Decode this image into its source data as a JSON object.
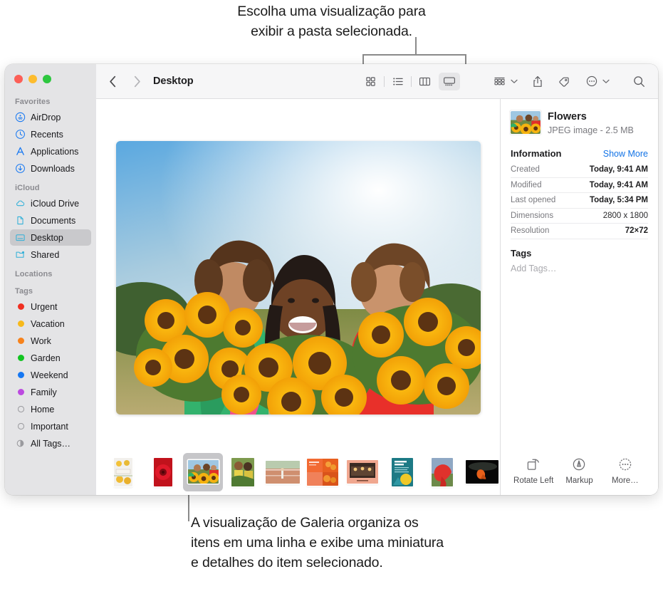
{
  "callouts": {
    "top": [
      "Escolha uma visualização para",
      "exibir a pasta selecionada."
    ],
    "bottom": [
      "A visualização de Galeria organiza os",
      "itens em uma linha e exibe uma miniatura",
      "e detalhes do item selecionado."
    ]
  },
  "window": {
    "traffic_lights": [
      "close",
      "minimize",
      "zoom"
    ],
    "colors": {
      "red": "#fc5f57",
      "yellow": "#fdbc2e",
      "green": "#2dc73f",
      "accent": "#1273e6",
      "selection": "#c9c9cc"
    }
  },
  "sidebar": {
    "sections": [
      {
        "header": "Favorites",
        "items": [
          {
            "label": "AirDrop",
            "icon": "airdrop-icon",
            "selected": false
          },
          {
            "label": "Recents",
            "icon": "clock-icon",
            "selected": false
          },
          {
            "label": "Applications",
            "icon": "applications-icon",
            "selected": false
          },
          {
            "label": "Downloads",
            "icon": "download-icon",
            "selected": false
          }
        ]
      },
      {
        "header": "iCloud",
        "items": [
          {
            "label": "iCloud Drive",
            "icon": "cloud-icon",
            "selected": false
          },
          {
            "label": "Documents",
            "icon": "document-icon",
            "selected": false
          },
          {
            "label": "Desktop",
            "icon": "desktop-icon",
            "selected": true
          },
          {
            "label": "Shared",
            "icon": "shared-folder-icon",
            "selected": false
          }
        ]
      },
      {
        "header": "Locations",
        "items": []
      },
      {
        "header": "Tags",
        "items": [
          {
            "label": "Urgent",
            "icon": "tag-dot-icon",
            "color": "#f02f21",
            "selected": false
          },
          {
            "label": "Vacation",
            "icon": "tag-dot-icon",
            "color": "#f7b91b",
            "selected": false
          },
          {
            "label": "Work",
            "icon": "tag-dot-icon",
            "color": "#f7821b",
            "selected": false
          },
          {
            "label": "Garden",
            "icon": "tag-dot-icon",
            "color": "#12c421",
            "selected": false
          },
          {
            "label": "Weekend",
            "icon": "tag-dot-icon",
            "color": "#1577f2",
            "selected": false
          },
          {
            "label": "Family",
            "icon": "tag-dot-icon",
            "color": "#bc4ae0",
            "selected": false
          },
          {
            "label": "Home",
            "icon": "tag-dot-hollow-icon",
            "color": "",
            "selected": false
          },
          {
            "label": "Important",
            "icon": "tag-dot-hollow-icon",
            "color": "",
            "selected": false
          },
          {
            "label": "All Tags…",
            "icon": "all-tags-icon",
            "color": "",
            "selected": false
          }
        ]
      }
    ]
  },
  "toolbar": {
    "back": "back-icon",
    "forward": "forward-icon",
    "title": "Desktop",
    "view_buttons": [
      {
        "name": "icon-view",
        "label": "Icon View",
        "active": false
      },
      {
        "name": "list-view",
        "label": "List View",
        "active": false
      },
      {
        "name": "column-view",
        "label": "Column View",
        "active": false
      },
      {
        "name": "gallery-view",
        "label": "Gallery View",
        "active": true
      }
    ],
    "actions": [
      {
        "name": "group-by",
        "label": "Group",
        "has_chevron": true
      },
      {
        "name": "share",
        "label": "Share",
        "has_chevron": false
      },
      {
        "name": "tags",
        "label": "Tags",
        "has_chevron": false
      },
      {
        "name": "more",
        "label": "More",
        "has_chevron": true
      },
      {
        "name": "search",
        "label": "Search",
        "has_chevron": false
      }
    ]
  },
  "gallery": {
    "preview_alt": "Three people holding large bouquets of sunflowers in a field",
    "filmstrip": [
      {
        "name": "district-poster",
        "selected": false
      },
      {
        "name": "red-flower",
        "selected": false
      },
      {
        "name": "flowers",
        "selected": true
      },
      {
        "name": "market-greens",
        "selected": false
      },
      {
        "name": "runner-track",
        "selected": false
      },
      {
        "name": "orange-collage",
        "selected": false
      },
      {
        "name": "restaurant-card",
        "selected": false
      },
      {
        "name": "marketing-flyer",
        "selected": false
      },
      {
        "name": "red-scarf-field",
        "selected": false
      },
      {
        "name": "dark-abstract",
        "selected": false
      },
      {
        "name": "chart-document",
        "selected": false
      }
    ]
  },
  "info": {
    "name": "Flowers",
    "subtitle": "JPEG image - 2.5 MB",
    "section_title": "Information",
    "show_more": "Show More",
    "rows": [
      {
        "key": "Created",
        "value": "Today, 9:41 AM",
        "bold": true
      },
      {
        "key": "Modified",
        "value": "Today, 9:41 AM",
        "bold": true
      },
      {
        "key": "Last opened",
        "value": "Today, 5:34 PM",
        "bold": true
      },
      {
        "key": "Dimensions",
        "value": "2800 x 1800",
        "bold": false
      },
      {
        "key": "Resolution",
        "value": "72×72",
        "bold": true
      }
    ],
    "tags_title": "Tags",
    "add_tags": "Add Tags…",
    "actions": [
      {
        "name": "rotate-left",
        "label": "Rotate Left"
      },
      {
        "name": "markup",
        "label": "Markup"
      },
      {
        "name": "more",
        "label": "More…"
      }
    ]
  }
}
